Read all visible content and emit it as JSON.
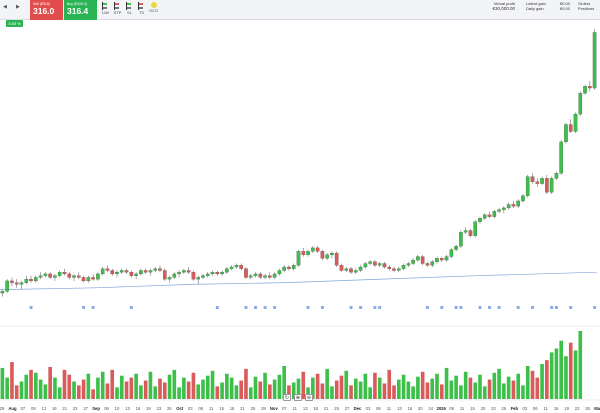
{
  "toolbar": {
    "sell": {
      "label": "Sell (€316)",
      "price": "316.0"
    },
    "buy": {
      "label": "Buy (€316.4)",
      "price": "316.4"
    },
    "order_tools": [
      {
        "label": "LIM",
        "icon": "limit-order-icon"
      },
      {
        "label": "STP",
        "icon": "stop-order-icon"
      },
      {
        "label": "SL",
        "icon": "stop-loss-icon"
      },
      {
        "label": "TS",
        "icon": "trailing-stop-icon"
      },
      {
        "label": "OCO",
        "icon": "oco-order-icon"
      }
    ],
    "virtual_profit_label": "Virtual profit",
    "virtual_profit_value": "€30,000.00",
    "latent_gain_label": "Latent gain",
    "latent_gain_value": "€0.00",
    "daily_gain_label": "Daily gain",
    "daily_gain_value": "€0.00",
    "orders_label": "Orders",
    "orders_value": "€0.00",
    "positions_label": "Positions",
    "positions_value": "€0.00"
  },
  "price_tag": "3.65 %",
  "colors": {
    "up": "#3cc04a",
    "down": "#d95b5b",
    "moving_average": "#7ea6d8",
    "event_marker": "#8aa9e8"
  },
  "x_axis_labels": [
    "29",
    "Aug",
    "07",
    "08",
    "13",
    "16",
    "21",
    "23",
    "27",
    "Sep",
    "06",
    "10",
    "13",
    "16",
    "19",
    "23",
    "26",
    "Oct",
    "03",
    "08",
    "11",
    "15",
    "18",
    "21",
    "25",
    "29",
    "Nov",
    "07",
    "11",
    "13",
    "18",
    "21",
    "25",
    "27",
    "Dec",
    "03",
    "06",
    "11",
    "13",
    "16",
    "20",
    "24",
    "2026",
    "08",
    "11",
    "15",
    "20",
    "23",
    "26",
    "Feb",
    "03",
    "06",
    "11",
    "16",
    "19",
    "23",
    "26",
    "Mar"
  ],
  "footer_controls": {
    "reset": "↻",
    "zoom_in": "⊕",
    "zoom_out": "⊖"
  },
  "chart_data": {
    "type": "candlestick",
    "title": "",
    "x_labels": [
      "29",
      "Aug",
      "07",
      "08",
      "13",
      "16",
      "21",
      "23",
      "27",
      "Sep",
      "06",
      "10",
      "13",
      "16",
      "19",
      "23",
      "26",
      "Oct",
      "03",
      "08",
      "11",
      "15",
      "18",
      "21",
      "25",
      "29",
      "Nov",
      "07",
      "11",
      "13",
      "18",
      "21",
      "25",
      "27",
      "Dec",
      "03",
      "06",
      "11",
      "13",
      "16",
      "20",
      "24",
      "2026",
      "08",
      "11",
      "15",
      "20",
      "23",
      "26",
      "Feb",
      "03",
      "06",
      "11",
      "16",
      "19",
      "23",
      "26",
      "Mar"
    ],
    "candles": [
      [
        100,
        101,
        99,
        100.5
      ],
      [
        100.5,
        104,
        100,
        103.5
      ],
      [
        103.5,
        104.5,
        102,
        103
      ],
      [
        103,
        104,
        101.5,
        102.5
      ],
      [
        102.5,
        103.5,
        101,
        103
      ],
      [
        103,
        105,
        102.5,
        104
      ],
      [
        104,
        105,
        103,
        103.5
      ],
      [
        103.5,
        105,
        103,
        104.5
      ],
      [
        104.5,
        106,
        104,
        105
      ],
      [
        105,
        106,
        104.5,
        105.5
      ],
      [
        105.5,
        106,
        104,
        104.5
      ],
      [
        104.5,
        105.5,
        103.5,
        105
      ],
      [
        105,
        106.5,
        104.5,
        106
      ],
      [
        106,
        107,
        105,
        105.5
      ],
      [
        105.5,
        106,
        104,
        104.5
      ],
      [
        104.5,
        105.5,
        103.5,
        105
      ],
      [
        105,
        106,
        104,
        104.5
      ],
      [
        104.5,
        105,
        103,
        103.5
      ],
      [
        103.5,
        105,
        103,
        104.5
      ],
      [
        104.5,
        105.5,
        103.5,
        104
      ],
      [
        104,
        106,
        103.5,
        105.5
      ],
      [
        105.5,
        107.5,
        105,
        107
      ],
      [
        107,
        108,
        106,
        106.5
      ],
      [
        106.5,
        107,
        105,
        105.5
      ],
      [
        105.5,
        106.5,
        104.5,
        106
      ],
      [
        106,
        107,
        105.5,
        106.5
      ],
      [
        106.5,
        107,
        105.5,
        106
      ],
      [
        106,
        106.5,
        104.5,
        105
      ],
      [
        105,
        106,
        104,
        105.5
      ],
      [
        105.5,
        107,
        105,
        106.5
      ],
      [
        106.5,
        107,
        105.5,
        106
      ],
      [
        106,
        107,
        105,
        106.5
      ],
      [
        106.5,
        107.5,
        106,
        107
      ],
      [
        107,
        108,
        106,
        106.5
      ],
      [
        106.5,
        107,
        103.5,
        104
      ],
      [
        104,
        105,
        103,
        104.5
      ],
      [
        104.5,
        106,
        104,
        105.5
      ],
      [
        105.5,
        106.5,
        104.5,
        106
      ],
      [
        106,
        107,
        105.5,
        106.5
      ],
      [
        106.5,
        107.5,
        105.5,
        106
      ],
      [
        106,
        106.5,
        103.5,
        104
      ],
      [
        104,
        105,
        102.5,
        104.5
      ],
      [
        104.5,
        105.5,
        104,
        105
      ],
      [
        105,
        106,
        104.5,
        105.5
      ],
      [
        105.5,
        106.5,
        105,
        106
      ],
      [
        106,
        106.5,
        105,
        105.5
      ],
      [
        105.5,
        106.5,
        105,
        106
      ],
      [
        106,
        107.5,
        105.5,
        107
      ],
      [
        107,
        108,
        106.5,
        107.5
      ],
      [
        107.5,
        108.5,
        107,
        108
      ],
      [
        108,
        108.5,
        106.5,
        107
      ],
      [
        107,
        107.5,
        104,
        104.5
      ],
      [
        104.5,
        105.5,
        104,
        105
      ],
      [
        105,
        106,
        104.5,
        105.5
      ],
      [
        105.5,
        106,
        104,
        104.5
      ],
      [
        104.5,
        105.5,
        104,
        105
      ],
      [
        105,
        106,
        104,
        104.5
      ],
      [
        104.5,
        106,
        104,
        105.5
      ],
      [
        105.5,
        107,
        105,
        106.5
      ],
      [
        106.5,
        108,
        106,
        107.5
      ],
      [
        107.5,
        108,
        106.5,
        107
      ],
      [
        107,
        108.5,
        106.5,
        108
      ],
      [
        108,
        112.5,
        107.5,
        112
      ],
      [
        112,
        113,
        110.5,
        111
      ],
      [
        111,
        112.5,
        110.5,
        112
      ],
      [
        112,
        113.5,
        111.5,
        113
      ],
      [
        113,
        113.5,
        111.5,
        112
      ],
      [
        112,
        112.5,
        109.5,
        110
      ],
      [
        110,
        111.5,
        109.5,
        111
      ],
      [
        111,
        112,
        110,
        111.5
      ],
      [
        111.5,
        112,
        107.5,
        108
      ],
      [
        108,
        108.5,
        106,
        106.5
      ],
      [
        106.5,
        107.5,
        106,
        107
      ],
      [
        107,
        107.5,
        105.5,
        106
      ],
      [
        106,
        107,
        105.5,
        106.5
      ],
      [
        106.5,
        108,
        106,
        107.5
      ],
      [
        107.5,
        109,
        107,
        108.5
      ],
      [
        108.5,
        109.5,
        108,
        109
      ],
      [
        109,
        109.5,
        107.5,
        108
      ],
      [
        108,
        109,
        107.5,
        108.5
      ],
      [
        108.5,
        109,
        107,
        107.5
      ],
      [
        107.5,
        108,
        106.5,
        107
      ],
      [
        107,
        107.5,
        106,
        106.5
      ],
      [
        106.5,
        107.5,
        106,
        107
      ],
      [
        107,
        108.5,
        106.5,
        108
      ],
      [
        108,
        109,
        107.5,
        108.5
      ],
      [
        108.5,
        110,
        108,
        109.5
      ],
      [
        109.5,
        111,
        109,
        110.5
      ],
      [
        110.5,
        111,
        108,
        108.5
      ],
      [
        108.5,
        109,
        107.5,
        108
      ],
      [
        108,
        109.5,
        107.5,
        109
      ],
      [
        109,
        110.5,
        108.5,
        110
      ],
      [
        110,
        110.5,
        109,
        109.5
      ],
      [
        109.5,
        111,
        109,
        110.5
      ],
      [
        110.5,
        113,
        110,
        112.5
      ],
      [
        112.5,
        114,
        112,
        113.5
      ],
      [
        113.5,
        118,
        113,
        117.5
      ],
      [
        117.5,
        119,
        117,
        118
      ],
      [
        118,
        118.5,
        116,
        116.5
      ],
      [
        116.5,
        121,
        116,
        120.5
      ],
      [
        120.5,
        122,
        120,
        121.5
      ],
      [
        121.5,
        123,
        121,
        122.5
      ],
      [
        122.5,
        123.5,
        121.5,
        122
      ],
      [
        122,
        124,
        121.5,
        123.5
      ],
      [
        123.5,
        124.5,
        123,
        124
      ],
      [
        124,
        125,
        123,
        124.5
      ],
      [
        124.5,
        126,
        124,
        125.5
      ],
      [
        125.5,
        126.5,
        124.5,
        125
      ],
      [
        125,
        127,
        124.5,
        126.5
      ],
      [
        126.5,
        128.5,
        126,
        128
      ],
      [
        128,
        134,
        127.5,
        133.5
      ],
      [
        133.5,
        134.5,
        131.5,
        132
      ],
      [
        132,
        133,
        130.5,
        131.5
      ],
      [
        131.5,
        133.5,
        131,
        133
      ],
      [
        133,
        134,
        128.5,
        129
      ],
      [
        129,
        133.5,
        128.5,
        133
      ],
      [
        133,
        135,
        132.5,
        134.5
      ],
      [
        134.5,
        144,
        134,
        143.5
      ],
      [
        143.5,
        149,
        143,
        148.5
      ],
      [
        148.5,
        150,
        146,
        146.5
      ],
      [
        146.5,
        152,
        146,
        151.5
      ],
      [
        151.5,
        158,
        151,
        157.5
      ],
      [
        157.5,
        160,
        157,
        159.5
      ],
      [
        159.5,
        161,
        158,
        159
      ],
      [
        159,
        176,
        158.5,
        175
      ]
    ],
    "volumes": [
      32,
      22,
      38,
      14,
      18,
      25,
      30,
      27,
      20,
      15,
      33,
      22,
      12,
      30,
      25,
      18,
      14,
      20,
      26,
      10,
      22,
      28,
      16,
      30,
      12,
      24,
      18,
      22,
      26,
      14,
      19,
      28,
      13,
      21,
      17,
      25,
      30,
      12,
      22,
      18,
      27,
      15,
      20,
      24,
      29,
      13,
      17,
      26,
      22,
      14,
      19,
      31,
      12,
      23,
      18,
      27,
      15,
      20,
      25,
      34,
      14,
      17,
      21,
      28,
      12,
      22,
      26,
      16,
      31,
      13,
      19,
      24,
      29,
      14,
      21,
      18,
      26,
      12,
      27,
      22,
      16,
      30,
      14,
      20,
      25,
      18,
      13,
      23,
      28,
      17,
      21,
      26,
      15,
      32,
      19,
      24,
      14,
      28,
      22,
      17,
      25,
      13,
      20,
      27,
      31,
      16,
      23,
      19,
      26,
      14,
      34,
      29,
      22,
      36,
      40,
      48,
      52,
      60,
      44,
      58,
      50,
      70
    ],
    "moving_average": [
      [
        0,
        101
      ],
      [
        20,
        101.5
      ],
      [
        40,
        102.5
      ],
      [
        60,
        103
      ],
      [
        80,
        104
      ],
      [
        100,
        105
      ],
      [
        125,
        106
      ]
    ],
    "event_markers": [
      6,
      17,
      19,
      27,
      45,
      51,
      53,
      55,
      57,
      64,
      67,
      73,
      75,
      78,
      79,
      89,
      92,
      95,
      96,
      100,
      102,
      104,
      108,
      111,
      115,
      116,
      119,
      124
    ],
    "y_range": [
      98,
      178
    ]
  }
}
